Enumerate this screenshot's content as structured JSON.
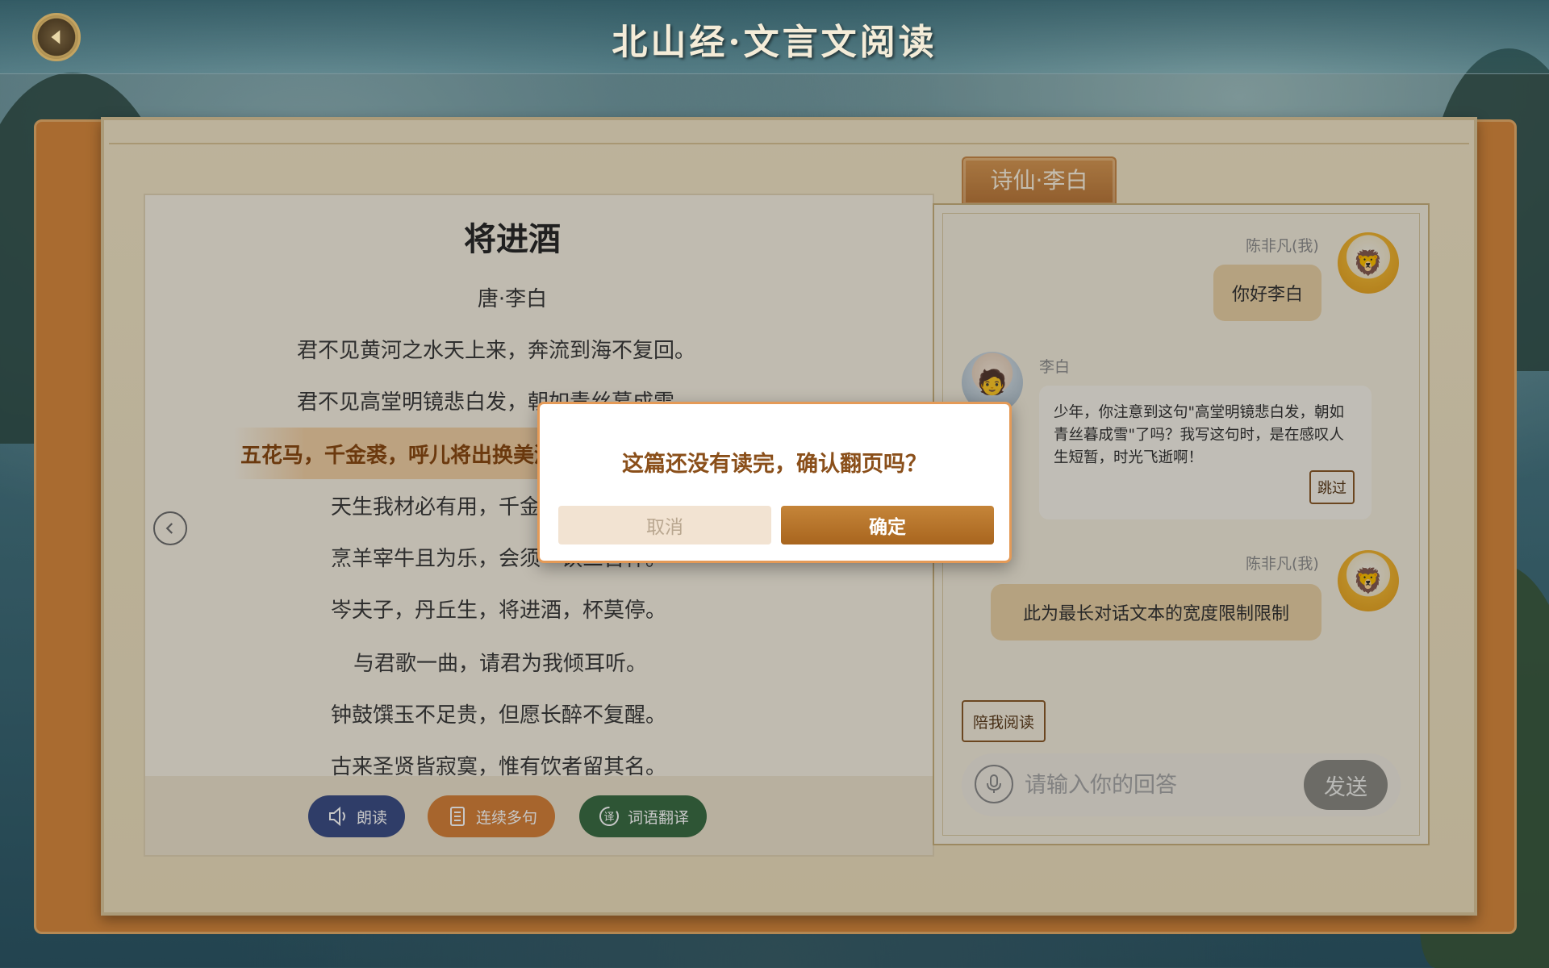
{
  "header": {
    "title": "北山经·文言文阅读",
    "back_icon": "back-arrow-icon"
  },
  "poem": {
    "title": "将进酒",
    "author": "唐·李白",
    "lines": [
      "君不见黄河之水天上来，奔流到海不复回。",
      "君不见高堂明镜悲白发，朝如青丝暮成雪。",
      "五花马，千金裘，呼儿将出换美酒，",
      "天生我材必有用，千金散尽还复来。",
      "烹羊宰牛且为乐，会须一饮三百杯。",
      "岑夫子，丹丘生，将进酒，杯莫停。",
      "与君歌一曲，请君为我倾耳听。",
      "钟鼓馔玉不足贵，但愿长醉不复醒。",
      "古来圣贤皆寂寞，惟有饮者留其名。"
    ],
    "highlighted_line_index": 2
  },
  "toolbar": {
    "read_aloud": "朗读",
    "continuous": "连续多句",
    "translate": "词语翻译",
    "colors": {
      "read_aloud": "#3d4f86",
      "continuous": "#d6823a",
      "translate": "#3c6e45"
    }
  },
  "chat": {
    "tab_label": "诗仙·李白",
    "messages": [
      {
        "sender": "陈非凡(我)",
        "text": "你好李白"
      },
      {
        "sender": "李白",
        "text": "少年，你注意到这句\"高堂明镜悲白发，朝如青丝暮成雪\"了吗？我写这句时，是在感叹人生短暂，时光飞逝啊！",
        "skip_label": "跳过"
      },
      {
        "sender": "陈非凡(我)",
        "text": "此为最长对话文本的宽度限制限制"
      }
    ],
    "accompany_label": "陪我阅读",
    "input_placeholder": "请输入你的回答",
    "send_label": "发送"
  },
  "dialog": {
    "message": "这篇还没有读完，确认翻页吗？",
    "cancel": "取消",
    "confirm": "确定"
  }
}
